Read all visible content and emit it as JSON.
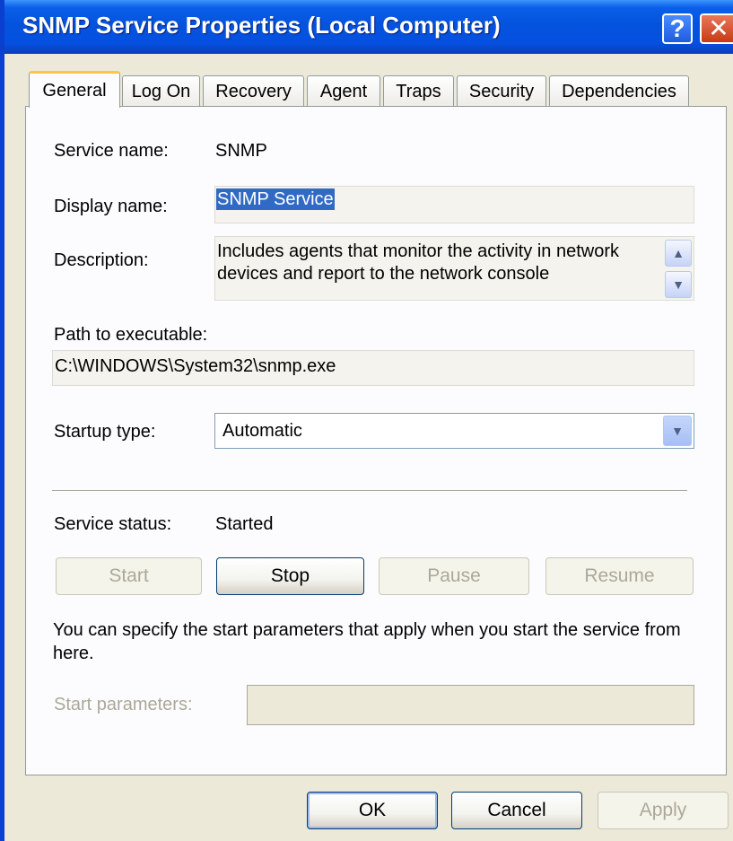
{
  "window": {
    "title": "SNMP Service Properties (Local Computer)",
    "help_label": "?",
    "close_label": "✕"
  },
  "tabs": [
    "General",
    "Log On",
    "Recovery",
    "Agent",
    "Traps",
    "Security",
    "Dependencies"
  ],
  "general": {
    "service_name_label": "Service name:",
    "service_name_value": "SNMP",
    "display_name_label": "Display name:",
    "display_name_value": "SNMP Service",
    "description_label": "Description:",
    "description_value": "Includes agents that monitor the activity in network devices and report to the network console",
    "path_label": "Path to executable:",
    "path_value": "C:\\WINDOWS\\System32\\snmp.exe",
    "startup_type_label": "Startup type:",
    "startup_type_value": "Automatic",
    "service_status_label": "Service status:",
    "service_status_value": "Started",
    "buttons": {
      "start": "Start",
      "stop": "Stop",
      "pause": "Pause",
      "resume": "Resume"
    },
    "hint_text": "You can specify the start parameters that apply when you start the service from here.",
    "start_parameters_label": "Start parameters:",
    "start_parameters_value": ""
  },
  "dialog_buttons": {
    "ok": "OK",
    "cancel": "Cancel",
    "apply": "Apply"
  },
  "colors": {
    "title_bar": "#0453DE",
    "dialog_bg": "#ECE9D8",
    "active_tab_highlight": "#FFC83C",
    "selection": "#316AC5"
  }
}
